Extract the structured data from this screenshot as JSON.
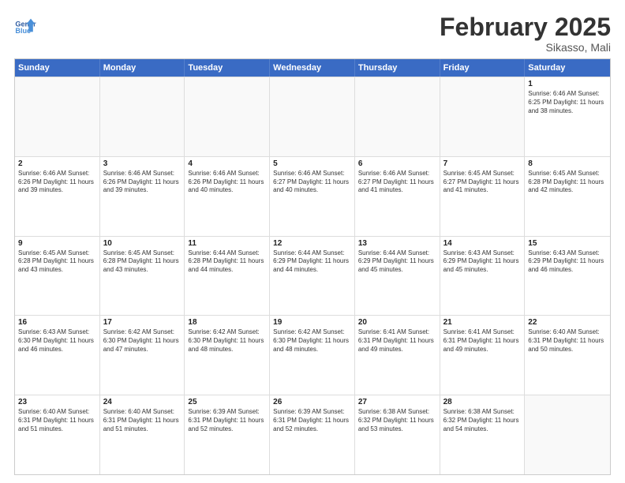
{
  "header": {
    "logo_general": "General",
    "logo_blue": "Blue",
    "month_title": "February 2025",
    "location": "Sikasso, Mali"
  },
  "calendar": {
    "days_of_week": [
      "Sunday",
      "Monday",
      "Tuesday",
      "Wednesday",
      "Thursday",
      "Friday",
      "Saturday"
    ],
    "weeks": [
      [
        {
          "day": "",
          "info": ""
        },
        {
          "day": "",
          "info": ""
        },
        {
          "day": "",
          "info": ""
        },
        {
          "day": "",
          "info": ""
        },
        {
          "day": "",
          "info": ""
        },
        {
          "day": "",
          "info": ""
        },
        {
          "day": "1",
          "info": "Sunrise: 6:46 AM\nSunset: 6:25 PM\nDaylight: 11 hours\nand 38 minutes."
        }
      ],
      [
        {
          "day": "2",
          "info": "Sunrise: 6:46 AM\nSunset: 6:26 PM\nDaylight: 11 hours\nand 39 minutes."
        },
        {
          "day": "3",
          "info": "Sunrise: 6:46 AM\nSunset: 6:26 PM\nDaylight: 11 hours\nand 39 minutes."
        },
        {
          "day": "4",
          "info": "Sunrise: 6:46 AM\nSunset: 6:26 PM\nDaylight: 11 hours\nand 40 minutes."
        },
        {
          "day": "5",
          "info": "Sunrise: 6:46 AM\nSunset: 6:27 PM\nDaylight: 11 hours\nand 40 minutes."
        },
        {
          "day": "6",
          "info": "Sunrise: 6:46 AM\nSunset: 6:27 PM\nDaylight: 11 hours\nand 41 minutes."
        },
        {
          "day": "7",
          "info": "Sunrise: 6:45 AM\nSunset: 6:27 PM\nDaylight: 11 hours\nand 41 minutes."
        },
        {
          "day": "8",
          "info": "Sunrise: 6:45 AM\nSunset: 6:28 PM\nDaylight: 11 hours\nand 42 minutes."
        }
      ],
      [
        {
          "day": "9",
          "info": "Sunrise: 6:45 AM\nSunset: 6:28 PM\nDaylight: 11 hours\nand 43 minutes."
        },
        {
          "day": "10",
          "info": "Sunrise: 6:45 AM\nSunset: 6:28 PM\nDaylight: 11 hours\nand 43 minutes."
        },
        {
          "day": "11",
          "info": "Sunrise: 6:44 AM\nSunset: 6:28 PM\nDaylight: 11 hours\nand 44 minutes."
        },
        {
          "day": "12",
          "info": "Sunrise: 6:44 AM\nSunset: 6:29 PM\nDaylight: 11 hours\nand 44 minutes."
        },
        {
          "day": "13",
          "info": "Sunrise: 6:44 AM\nSunset: 6:29 PM\nDaylight: 11 hours\nand 45 minutes."
        },
        {
          "day": "14",
          "info": "Sunrise: 6:43 AM\nSunset: 6:29 PM\nDaylight: 11 hours\nand 45 minutes."
        },
        {
          "day": "15",
          "info": "Sunrise: 6:43 AM\nSunset: 6:29 PM\nDaylight: 11 hours\nand 46 minutes."
        }
      ],
      [
        {
          "day": "16",
          "info": "Sunrise: 6:43 AM\nSunset: 6:30 PM\nDaylight: 11 hours\nand 46 minutes."
        },
        {
          "day": "17",
          "info": "Sunrise: 6:42 AM\nSunset: 6:30 PM\nDaylight: 11 hours\nand 47 minutes."
        },
        {
          "day": "18",
          "info": "Sunrise: 6:42 AM\nSunset: 6:30 PM\nDaylight: 11 hours\nand 48 minutes."
        },
        {
          "day": "19",
          "info": "Sunrise: 6:42 AM\nSunset: 6:30 PM\nDaylight: 11 hours\nand 48 minutes."
        },
        {
          "day": "20",
          "info": "Sunrise: 6:41 AM\nSunset: 6:31 PM\nDaylight: 11 hours\nand 49 minutes."
        },
        {
          "day": "21",
          "info": "Sunrise: 6:41 AM\nSunset: 6:31 PM\nDaylight: 11 hours\nand 49 minutes."
        },
        {
          "day": "22",
          "info": "Sunrise: 6:40 AM\nSunset: 6:31 PM\nDaylight: 11 hours\nand 50 minutes."
        }
      ],
      [
        {
          "day": "23",
          "info": "Sunrise: 6:40 AM\nSunset: 6:31 PM\nDaylight: 11 hours\nand 51 minutes."
        },
        {
          "day": "24",
          "info": "Sunrise: 6:40 AM\nSunset: 6:31 PM\nDaylight: 11 hours\nand 51 minutes."
        },
        {
          "day": "25",
          "info": "Sunrise: 6:39 AM\nSunset: 6:31 PM\nDaylight: 11 hours\nand 52 minutes."
        },
        {
          "day": "26",
          "info": "Sunrise: 6:39 AM\nSunset: 6:31 PM\nDaylight: 11 hours\nand 52 minutes."
        },
        {
          "day": "27",
          "info": "Sunrise: 6:38 AM\nSunset: 6:32 PM\nDaylight: 11 hours\nand 53 minutes."
        },
        {
          "day": "28",
          "info": "Sunrise: 6:38 AM\nSunset: 6:32 PM\nDaylight: 11 hours\nand 54 minutes."
        },
        {
          "day": "",
          "info": ""
        }
      ]
    ]
  }
}
